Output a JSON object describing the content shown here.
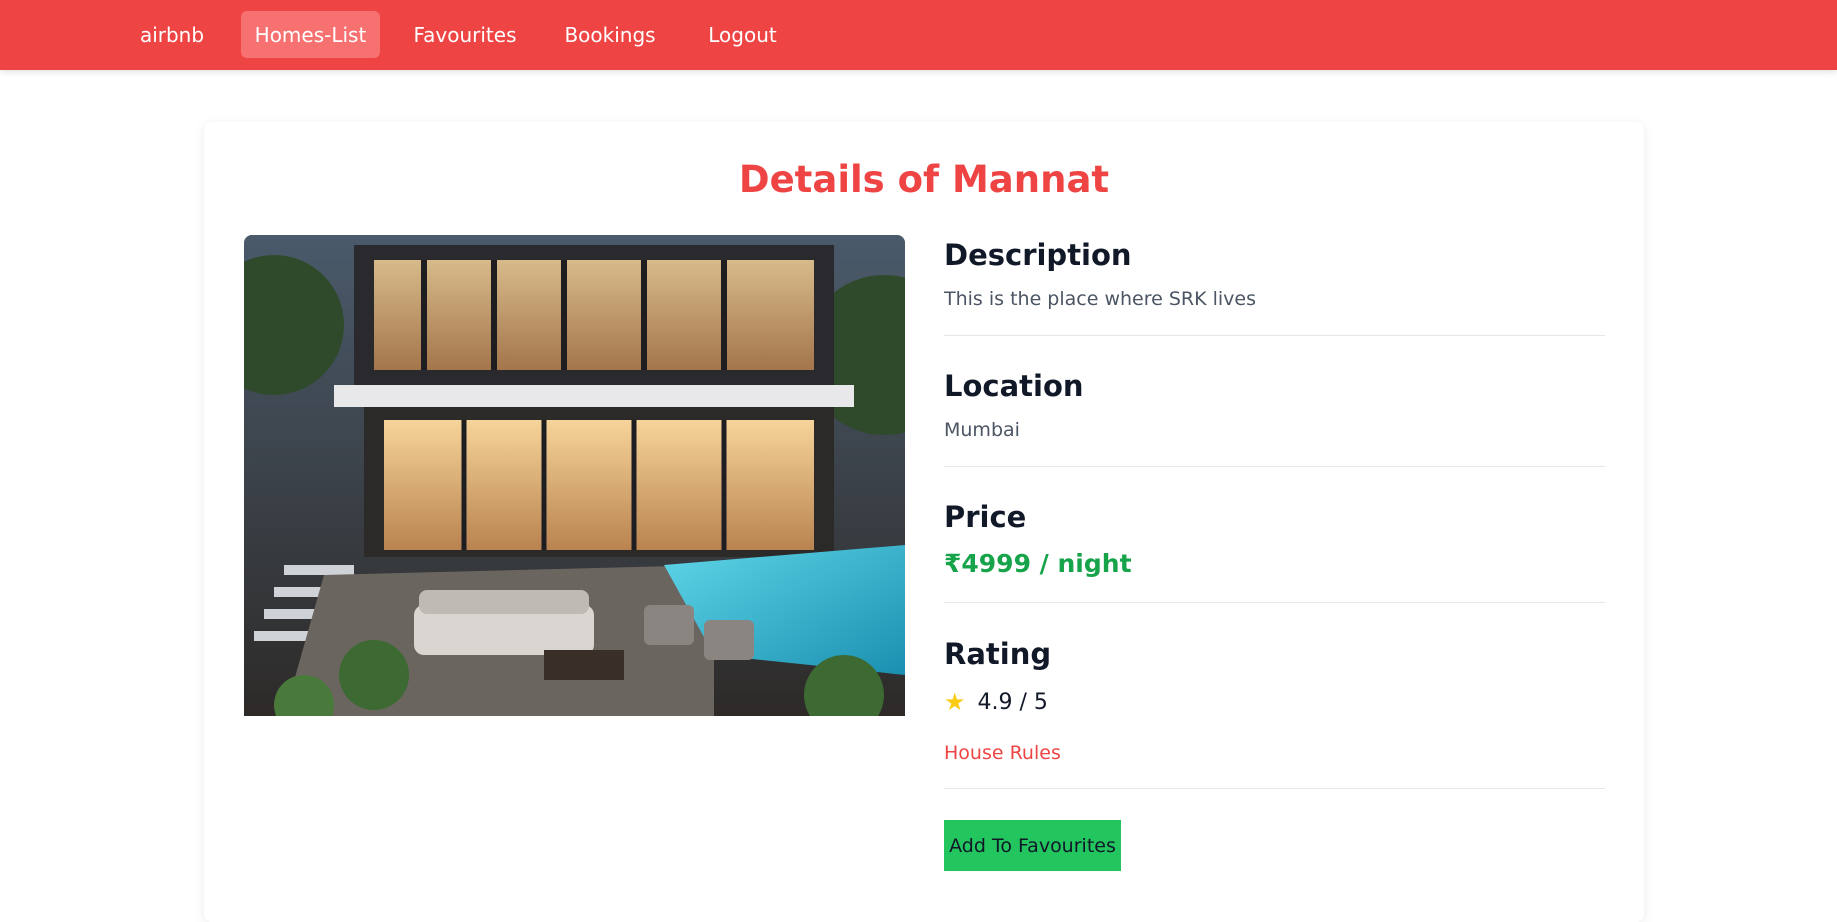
{
  "nav": {
    "brand": "airbnb",
    "items": [
      {
        "label": "Homes-List",
        "active": true
      },
      {
        "label": "Favourites",
        "active": false
      },
      {
        "label": "Bookings",
        "active": false
      },
      {
        "label": "Logout",
        "active": false
      }
    ]
  },
  "colors": {
    "nav_bg": "#ef4444",
    "nav_active": "#f87171",
    "accent": "#ef4444",
    "price": "#16a34a",
    "button": "#22c55e",
    "star": "#facc15"
  },
  "home": {
    "title": "Details of Mannat",
    "image_alt": "Mannat",
    "description_heading": "Description",
    "description": "This is the place where SRK lives",
    "location_heading": "Location",
    "location": "Mumbai",
    "price_heading": "Price",
    "price": "₹4999 / night",
    "rating_heading": "Rating",
    "rating_icon": "star-icon",
    "rating": "4.9 / 5",
    "rules_link": "House Rules",
    "favourite_button": "Add To Favourites"
  }
}
